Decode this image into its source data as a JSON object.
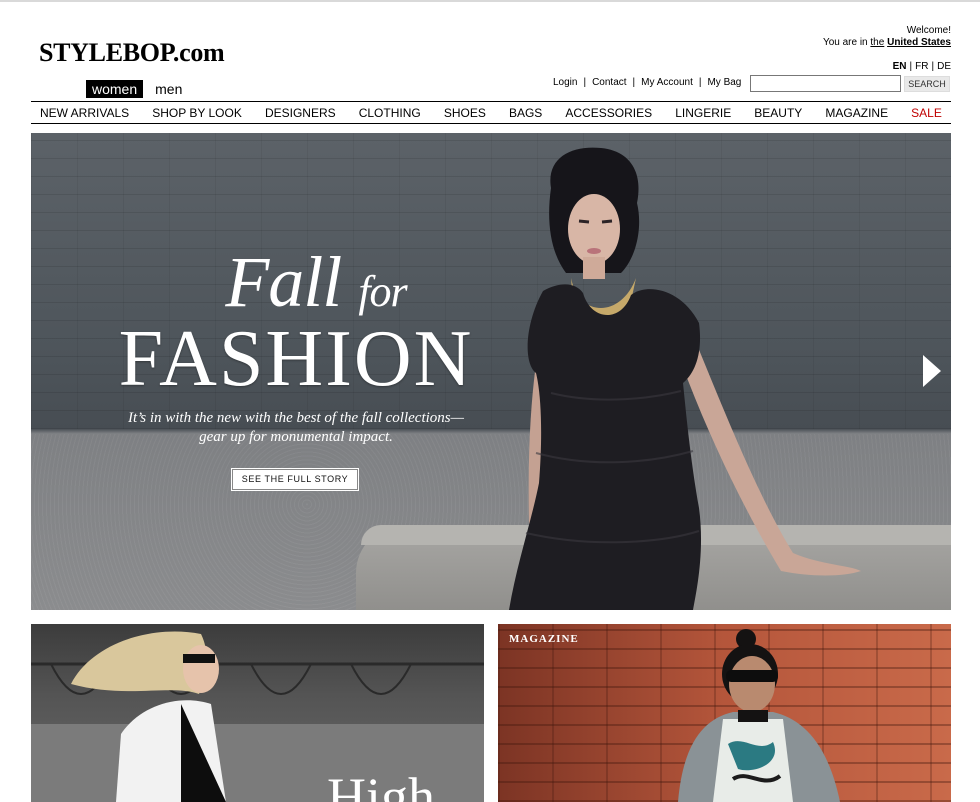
{
  "header": {
    "logo": "STYLEBOP.com",
    "gender_tabs": [
      {
        "label": "women",
        "active": true
      },
      {
        "label": "men",
        "active": false
      }
    ],
    "welcome": "Welcome!",
    "location_prefix": "You are in ",
    "location_link_pre": "the",
    "location_country": "United States",
    "languages": [
      {
        "label": "EN",
        "active": true
      },
      {
        "label": "FR",
        "active": false
      },
      {
        "label": "DE",
        "active": false
      }
    ],
    "utility_links": [
      "Login",
      "Contact",
      "My Account",
      "My Bag"
    ],
    "search": {
      "value": "",
      "placeholder": "",
      "button_label": "SEARCH"
    }
  },
  "nav": {
    "items": [
      "NEW ARRIVALS",
      "SHOP BY LOOK",
      "DESIGNERS",
      "CLOTHING",
      "SHOES",
      "BAGS",
      "ACCESSORIES",
      "LINGERIE",
      "BEAUTY",
      "MAGAZINE",
      "SALE"
    ],
    "sale_color": "#c00000"
  },
  "hero": {
    "headline_fall": "Fall",
    "headline_for": "for",
    "headline_fashion": "FASHION",
    "tagline_line1": "It’s in with the new with the best of the fall collections—",
    "tagline_line2": "gear up for monumental impact.",
    "cta_label": "SEE THE FULL STORY",
    "next_icon": "chevron-right-icon"
  },
  "cards": {
    "left_text": "High",
    "right_label": "MAGAZINE"
  }
}
